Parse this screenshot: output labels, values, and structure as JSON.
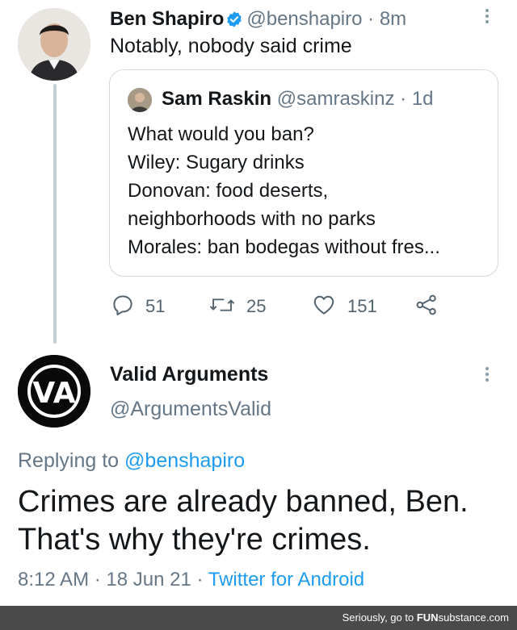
{
  "tweet": {
    "author_name": "Ben Shapiro",
    "author_handle": "@benshapiro",
    "separator": "·",
    "time_ago": "8m",
    "text": "Notably, nobody said crime",
    "quote": {
      "author_name": "Sam Raskin",
      "author_handle": "@samraskinz",
      "time_ago": "1d",
      "lines": [
        "What would you ban?",
        "Wiley: Sugary drinks",
        "Donovan: food deserts,",
        "neighborhoods with no parks",
        "Morales: ban bodegas without fres..."
      ]
    },
    "actions": {
      "reply_count": "51",
      "retweet_count": "25",
      "like_count": "151"
    }
  },
  "reply": {
    "author_name": "Valid Arguments",
    "author_handle": "@ArgumentsValid",
    "avatar_logo_text": "VA",
    "replying_prefix": "Replying to",
    "replying_to": "@benshapiro",
    "text_lines": [
      "Crimes are already banned, Ben.",
      "That's why they're crimes."
    ],
    "time": "8:12 AM",
    "date": "18 Jun 21",
    "source": "Twitter for Android"
  },
  "footer": {
    "text_prefix": "Seriously, go to",
    "brand_part1": "FUN",
    "brand_part2": "substance",
    "brand_suffix": ".com"
  },
  "icons": {
    "verified": "verified-badge-icon",
    "reply": "reply-icon",
    "retweet": "retweet-icon",
    "like": "heart-icon",
    "share": "share-icon",
    "more": "more-options-icon"
  },
  "colors": {
    "link_blue": "#1d9bf0",
    "muted_gray": "#657786",
    "text": "#14171a",
    "footer_bg": "#4a4a4a"
  }
}
